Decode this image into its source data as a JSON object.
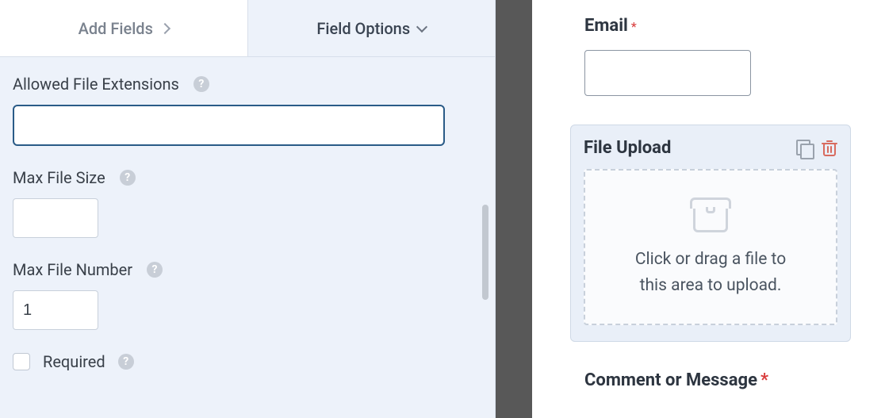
{
  "tabs": {
    "add_fields": "Add Fields",
    "field_options": "Field Options"
  },
  "options": {
    "allowed_ext_label": "Allowed File Extensions",
    "allowed_ext_value": "",
    "max_size_label": "Max File Size",
    "max_size_value": "",
    "max_num_label": "Max File Number",
    "max_num_value": "1",
    "required_label": "Required"
  },
  "preview": {
    "email_label": "Email",
    "upload_title": "File Upload",
    "drop_line1": "Click or drag a file to",
    "drop_line2": "this area to upload.",
    "comment_label": "Comment or Message",
    "required_marker": "*"
  }
}
